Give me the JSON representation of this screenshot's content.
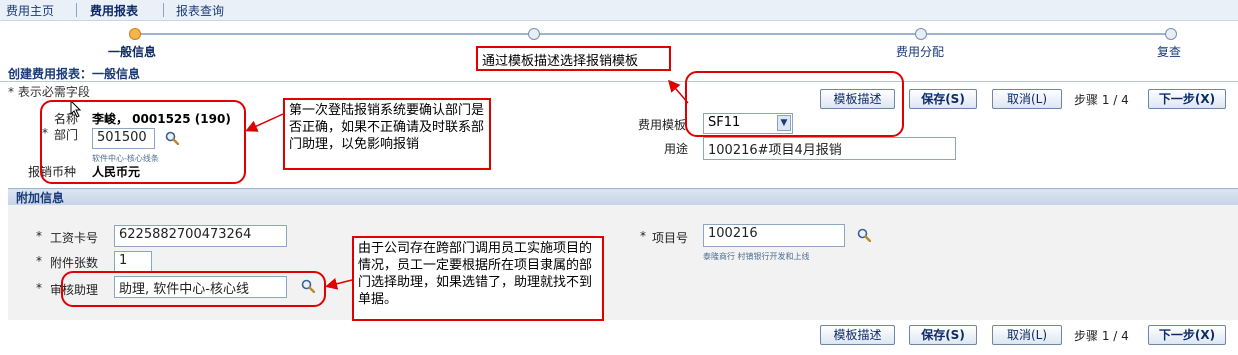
{
  "nav": {
    "items": [
      "费用主页",
      "费用报表",
      "报表查询"
    ]
  },
  "train": {
    "steps": [
      "一般信息",
      "",
      "费用分配",
      "复查"
    ]
  },
  "page": {
    "title": "创建费用报表：一般信息",
    "required_note": "* 表示必需字段"
  },
  "general": {
    "name_label": "名称",
    "name_value": "李峻， 0001525 (190)",
    "dept_label": "部门",
    "dept_value": "501500",
    "dept_hint": "软件中心-核心线条",
    "currency_label": "报销币种",
    "currency_value": "人民币元",
    "template_label": "费用模板",
    "template_value": "SF11",
    "purpose_label": "用途",
    "purpose_value": "100216#项目4月报销"
  },
  "buttons": {
    "template_desc": "模板描述",
    "save": "保存(S)",
    "cancel": "取消(L)",
    "step": "步骤 1 / 4",
    "next": "下一步(X)"
  },
  "additional": {
    "section_title": "附加信息",
    "salary_card_label": "工资卡号",
    "salary_card_value": "6225882700473264",
    "attachments_label": "附件张数",
    "attachments_value": "1",
    "approver_label": "审核助理",
    "approver_value": "助理, 软件中心-核心线",
    "project_label": "项目号",
    "project_value": "100216",
    "project_hint": "泰隆商行 村镇银行开发和上线"
  },
  "annotations": {
    "template_note": "通过模板描述选择报销模板",
    "dept_note": "第一次登陆报销系统要确认部门是否正确，如果不正确请及时联系部门助理，以免影响报销",
    "approver_note": "由于公司存在跨部门调用员工实施项目的情况，员工一定要根据所在项目隶属的部门选择助理，如果选错了，助理就找不到单据。"
  },
  "colors": {
    "accent": "#1a3a78",
    "annotation": "#e00000",
    "current_step": "#f7b54a"
  }
}
